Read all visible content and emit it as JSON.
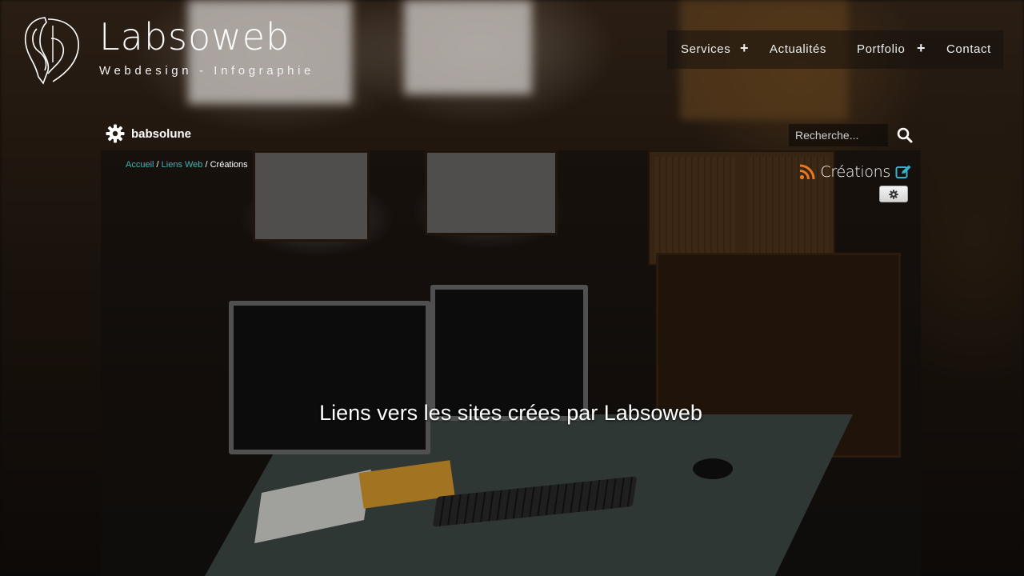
{
  "brand": {
    "name": "Labsoweb",
    "tagline": "Webdesign - Infographie"
  },
  "nav": {
    "items": [
      {
        "label": "Services",
        "has_submenu": true
      },
      {
        "label": "Actualités",
        "has_submenu": false
      },
      {
        "label": "Portfolio",
        "has_submenu": true
      },
      {
        "label": "Contact",
        "has_submenu": false
      }
    ],
    "submenu_symbol": "+"
  },
  "user": {
    "name": "babsolune",
    "icon": "gear-icon"
  },
  "search": {
    "placeholder": "Recherche...",
    "icon": "search-icon"
  },
  "breadcrumb": {
    "items": [
      "Accueil",
      "Liens Web",
      "Créations"
    ],
    "separator": " / "
  },
  "page": {
    "title": "Créations",
    "rss_icon": "rss-icon",
    "edit_icon": "edit-icon",
    "settings_icon": "gear-icon",
    "hero_text": "Liens vers les sites crées par Labsoweb"
  },
  "colors": {
    "accent": "#3cb6b6",
    "rss": "#e8781e",
    "edit": "#38b2c8"
  }
}
